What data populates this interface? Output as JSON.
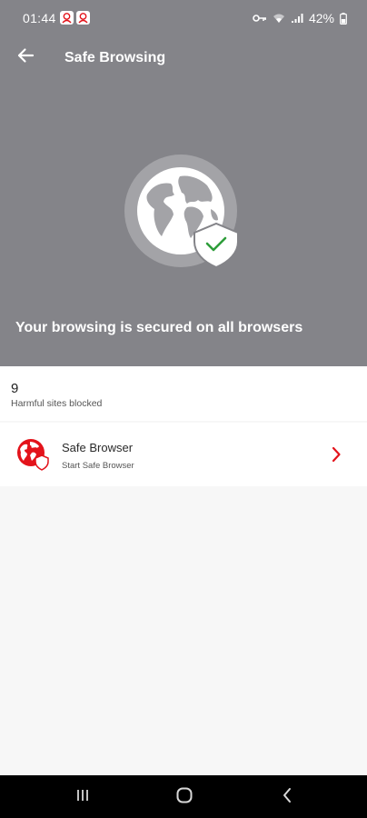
{
  "status_bar": {
    "time": "01:44",
    "battery": "42%",
    "icons": [
      "notification-icon",
      "notification-icon",
      "vpn-key-icon",
      "wifi-icon",
      "signal-icon",
      "battery-icon"
    ]
  },
  "app_bar": {
    "title": "Safe Browsing",
    "back_icon": "arrow-left-icon"
  },
  "hero": {
    "icon": "globe-shield-check-icon",
    "message": "Your browsing is secured on all browsers",
    "background": "#848489"
  },
  "stats": {
    "count": "9",
    "label": "Harmful sites blocked"
  },
  "safe_browser": {
    "title": "Safe Browser",
    "subtitle": "Start Safe Browser",
    "icon": "globe-shield-icon",
    "accent": "#e3131b"
  },
  "nav_bar": {
    "buttons": [
      "recents-icon",
      "home-icon",
      "back-icon"
    ]
  }
}
